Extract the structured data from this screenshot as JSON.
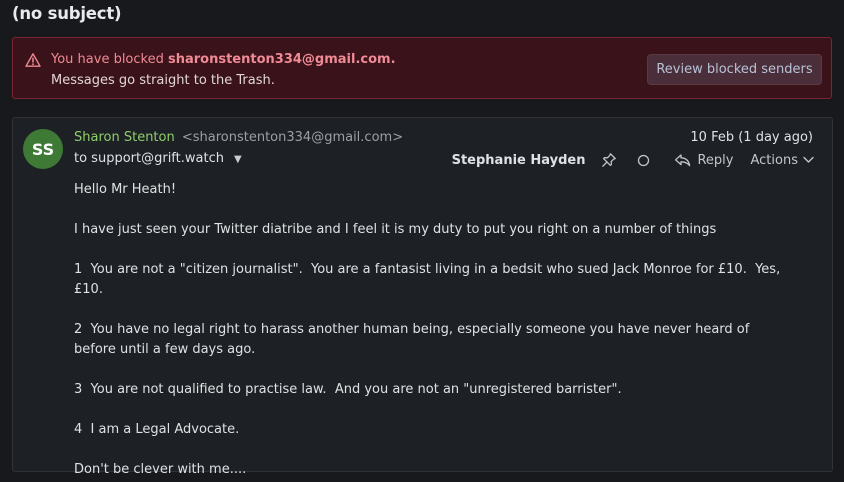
{
  "email": {
    "subject": "(no subject)",
    "blocked_banner": {
      "prefix": "You have blocked ",
      "blocked_email": "sharonstenton334@gmail.com",
      "suffix": ".",
      "subtitle": "Messages go straight to the Trash.",
      "review_button": "Review blocked senders",
      "icon": "warning-icon",
      "accent_color": "#f08a95"
    },
    "message": {
      "avatar_initials": "SS",
      "avatar_color": "#3e7a35",
      "sender_name": "Sharon Stenton",
      "sender_email": "<sharonstenton334@gmail.com>",
      "to": "to support@grift.watch",
      "date": "10 Feb (1 day ago)",
      "assignee": "Stephanie Hayden",
      "reply_label": "Reply",
      "actions_label": "Actions",
      "body": [
        "Hello Mr Heath!",
        "I have just seen your Twitter diatribe and I feel it is my duty to put you right on a number of things",
        "1  You are not a \"citizen journalist\".  You are a fantasist living in a bedsit who sued Jack Monroe for £10.  Yes, £10.",
        "2  You have no legal right to harass another human being, especially someone you have never heard of before until a few days ago.",
        "3  You are not qualified to practise law.  And you are not an \"unregistered barrister\".",
        "4  I am a Legal Advocate.",
        "Don't be clever with me...."
      ]
    }
  }
}
